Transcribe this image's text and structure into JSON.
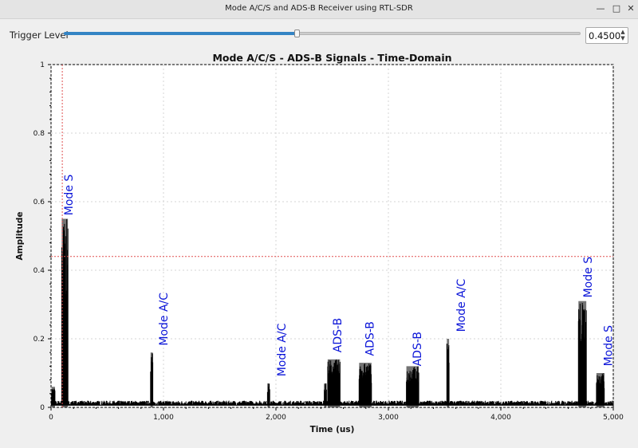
{
  "window": {
    "title": "Mode A/C/S and ADS-B Receiver using RTL-SDR",
    "minimize_icon": "minimize-icon",
    "maximize_icon": "maximize-icon",
    "close_icon": "close-icon"
  },
  "trigger": {
    "label": "Trigger Level",
    "value_text": "0.4500",
    "level": 0.45
  },
  "chart_data": {
    "type": "line",
    "title": "Mode A/C/S - ADS-B Signals - Time-Domain",
    "xlabel": "Time (us)",
    "ylabel": "Amplitude",
    "xlim": [
      0,
      5000
    ],
    "ylim": [
      0,
      1
    ],
    "grid": true,
    "x_ticks": [
      {
        "v": 0,
        "label": "0"
      },
      {
        "v": 1000,
        "label": "1,000"
      },
      {
        "v": 2000,
        "label": "2,000"
      },
      {
        "v": 3000,
        "label": "3,000"
      },
      {
        "v": 4000,
        "label": "4,000"
      },
      {
        "v": 5000,
        "label": "5,000"
      }
    ],
    "y_ticks": [
      {
        "v": 0,
        "label": "0"
      },
      {
        "v": 0.2,
        "label": "0.2"
      },
      {
        "v": 0.4,
        "label": "0.4"
      },
      {
        "v": 0.6,
        "label": "0.6"
      },
      {
        "v": 0.8,
        "label": "0.8"
      },
      {
        "v": 1,
        "label": "1"
      }
    ],
    "noise_floor": 0.015,
    "trigger_time_us": 100,
    "trigger_level": 0.44,
    "bursts": [
      {
        "start": 5,
        "end": 35,
        "peak": 0.06
      },
      {
        "start": 95,
        "end": 150,
        "peak": 0.55
      },
      {
        "start": 885,
        "end": 905,
        "peak": 0.16
      },
      {
        "start": 1925,
        "end": 1945,
        "peak": 0.07
      },
      {
        "start": 2430,
        "end": 2450,
        "peak": 0.07
      },
      {
        "start": 2460,
        "end": 2570,
        "peak": 0.14
      },
      {
        "start": 2740,
        "end": 2850,
        "peak": 0.13
      },
      {
        "start": 3160,
        "end": 3270,
        "peak": 0.12
      },
      {
        "start": 3520,
        "end": 3540,
        "peak": 0.2
      },
      {
        "start": 4690,
        "end": 4760,
        "peak": 0.31
      },
      {
        "start": 4850,
        "end": 4920,
        "peak": 0.1
      }
    ],
    "annotations": [
      {
        "text": "Mode S",
        "x": 190,
        "y": 0.56
      },
      {
        "text": "Mode A/C",
        "x": 1035,
        "y": 0.18
      },
      {
        "text": "Mode A/C",
        "x": 2085,
        "y": 0.09
      },
      {
        "text": "ADS-B",
        "x": 2580,
        "y": 0.16
      },
      {
        "text": "ADS-B",
        "x": 2870,
        "y": 0.15
      },
      {
        "text": "ADS-B",
        "x": 3290,
        "y": 0.12
      },
      {
        "text": "Mode A/C",
        "x": 3680,
        "y": 0.22
      },
      {
        "text": "Mode S",
        "x": 4810,
        "y": 0.32
      },
      {
        "text": "Mode S",
        "x": 4990,
        "y": 0.12
      }
    ]
  }
}
